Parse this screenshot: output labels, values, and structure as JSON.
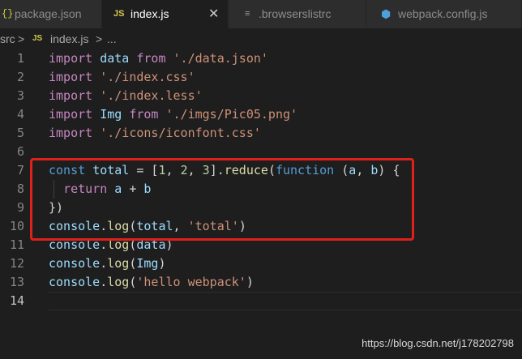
{
  "tabs": [
    {
      "icon": "{}",
      "label": "package.json",
      "active": false
    },
    {
      "icon": "JS",
      "label": "index.js",
      "active": true,
      "close": "✕"
    },
    {
      "icon": "≡",
      "label": ".browserslistrc",
      "active": false
    },
    {
      "icon": "⬢",
      "label": "webpack.config.js",
      "active": false
    }
  ],
  "breadcrumb": {
    "folder": "src",
    "sep1": ">",
    "file_icon": "JS",
    "file": "index.js",
    "sep2": ">",
    "tail": "..."
  },
  "line_numbers": [
    "1",
    "2",
    "3",
    "4",
    "5",
    "6",
    "7",
    "8",
    "9",
    "10",
    "11",
    "12",
    "13",
    "14"
  ],
  "code_lines": [
    [
      {
        "t": "import",
        "c": "kw-i"
      },
      {
        "t": " data ",
        "c": "var"
      },
      {
        "t": "from",
        "c": "kw-i"
      },
      {
        "t": " ",
        "c": "pun"
      },
      {
        "t": "'./data.json'",
        "c": "str"
      }
    ],
    [
      {
        "t": "import",
        "c": "kw-i"
      },
      {
        "t": " ",
        "c": "pun"
      },
      {
        "t": "'./index.css'",
        "c": "str"
      }
    ],
    [
      {
        "t": "import",
        "c": "kw-i"
      },
      {
        "t": " ",
        "c": "pun"
      },
      {
        "t": "'./index.less'",
        "c": "str"
      }
    ],
    [
      {
        "t": "import",
        "c": "kw-i"
      },
      {
        "t": " Img ",
        "c": "var"
      },
      {
        "t": "from",
        "c": "kw-i"
      },
      {
        "t": " ",
        "c": "pun"
      },
      {
        "t": "'./imgs/Pic05.png'",
        "c": "str"
      }
    ],
    [
      {
        "t": "import",
        "c": "kw-i"
      },
      {
        "t": " ",
        "c": "pun"
      },
      {
        "t": "'./icons/iconfont.css'",
        "c": "str"
      }
    ],
    [],
    [
      {
        "t": "const",
        "c": "kw"
      },
      {
        "t": " ",
        "c": "pun"
      },
      {
        "t": "total",
        "c": "var"
      },
      {
        "t": " = [",
        "c": "pun"
      },
      {
        "t": "1",
        "c": "num"
      },
      {
        "t": ", ",
        "c": "pun"
      },
      {
        "t": "2",
        "c": "num"
      },
      {
        "t": ", ",
        "c": "pun"
      },
      {
        "t": "3",
        "c": "num"
      },
      {
        "t": "].",
        "c": "pun"
      },
      {
        "t": "reduce",
        "c": "fn"
      },
      {
        "t": "(",
        "c": "pun"
      },
      {
        "t": "function",
        "c": "kw"
      },
      {
        "t": " (",
        "c": "pun"
      },
      {
        "t": "a",
        "c": "var"
      },
      {
        "t": ", ",
        "c": "pun"
      },
      {
        "t": "b",
        "c": "var"
      },
      {
        "t": ") {",
        "c": "pun"
      }
    ],
    [
      {
        "t": "  ",
        "c": "pun"
      },
      {
        "t": "return",
        "c": "kw-i"
      },
      {
        "t": " ",
        "c": "pun"
      },
      {
        "t": "a",
        "c": "var"
      },
      {
        "t": " + ",
        "c": "pun"
      },
      {
        "t": "b",
        "c": "var"
      }
    ],
    [
      {
        "t": "})",
        "c": "pun"
      }
    ],
    [
      {
        "t": "console",
        "c": "var"
      },
      {
        "t": ".",
        "c": "pun"
      },
      {
        "t": "log",
        "c": "fn"
      },
      {
        "t": "(",
        "c": "pun"
      },
      {
        "t": "total",
        "c": "var"
      },
      {
        "t": ", ",
        "c": "pun"
      },
      {
        "t": "'total'",
        "c": "str"
      },
      {
        "t": ")",
        "c": "pun"
      }
    ],
    [
      {
        "t": "console",
        "c": "var"
      },
      {
        "t": ".",
        "c": "pun"
      },
      {
        "t": "log",
        "c": "fn"
      },
      {
        "t": "(",
        "c": "pun"
      },
      {
        "t": "data",
        "c": "var"
      },
      {
        "t": ")",
        "c": "pun"
      }
    ],
    [
      {
        "t": "console",
        "c": "var"
      },
      {
        "t": ".",
        "c": "pun"
      },
      {
        "t": "log",
        "c": "fn"
      },
      {
        "t": "(",
        "c": "pun"
      },
      {
        "t": "Img",
        "c": "var"
      },
      {
        "t": ")",
        "c": "pun"
      }
    ],
    [
      {
        "t": "console",
        "c": "var"
      },
      {
        "t": ".",
        "c": "pun"
      },
      {
        "t": "log",
        "c": "fn"
      },
      {
        "t": "(",
        "c": "pun"
      },
      {
        "t": "'hello webpack'",
        "c": "str"
      },
      {
        "t": ")",
        "c": "pun"
      }
    ],
    []
  ],
  "current_line": 14,
  "highlight_color": "#e0201a",
  "watermark": "https://blog.csdn.net/j178202798"
}
